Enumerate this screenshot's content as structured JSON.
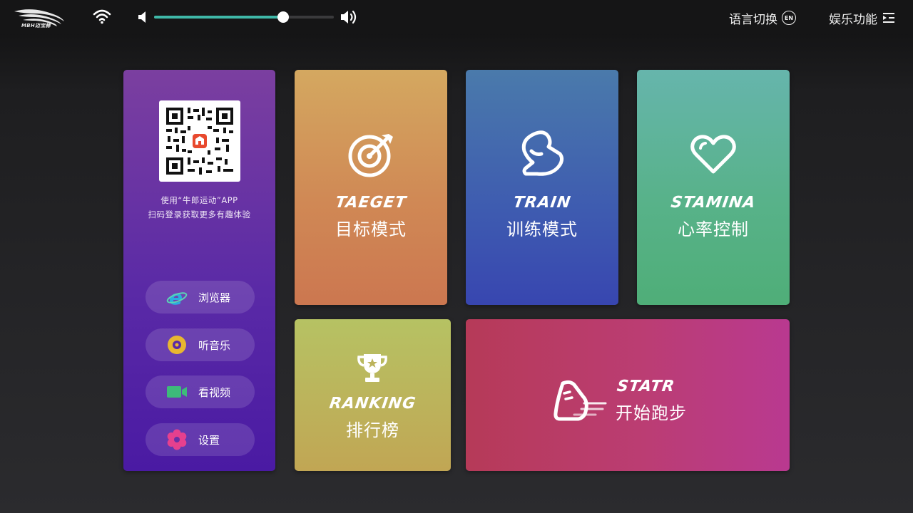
{
  "topbar": {
    "brand_text": "MBH迈宝赫",
    "volume_level": 0.72,
    "language_label": "语言切换",
    "language_badge": "EN",
    "entertainment_label": "娱乐功能"
  },
  "side_panel": {
    "qr_line1": "使用“牛郎运动”APP",
    "qr_line2": "扫码登录获取更多有趣体验",
    "items": [
      {
        "label": "浏览器",
        "icon": "browser-icon"
      },
      {
        "label": "听音乐",
        "icon": "music-icon"
      },
      {
        "label": "看视频",
        "icon": "video-icon"
      },
      {
        "label": "设置",
        "icon": "settings-icon"
      }
    ]
  },
  "tiles": {
    "target": {
      "en": "TAEGET",
      "cn": "目标模式",
      "icon": "target-icon"
    },
    "train": {
      "en": "TRAIN",
      "cn": "训练模式",
      "icon": "muscle-icon"
    },
    "stamina": {
      "en": "STAMINA",
      "cn": "心率控制",
      "icon": "heart-icon"
    },
    "ranking": {
      "en": "RANKING",
      "cn": "排行榜",
      "icon": "trophy-icon"
    },
    "start": {
      "en": "STATR",
      "cn": "开始跑步",
      "icon": "shoe-icon"
    }
  },
  "colors": {
    "accent": "#3fb8a8",
    "side_panel": "#5a2aa6",
    "target": "#d08955",
    "train": "#3e5bb0",
    "stamina": "#58b28a",
    "ranking": "#bcb35b",
    "start": "#bb3d73"
  }
}
